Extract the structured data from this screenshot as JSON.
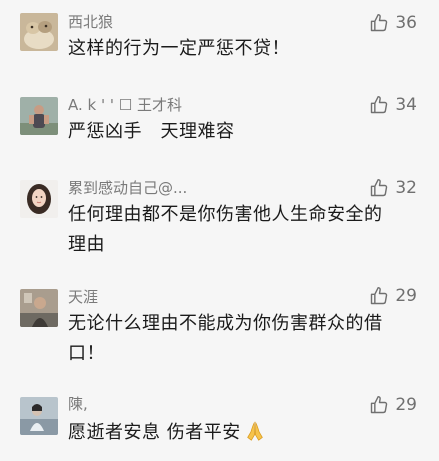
{
  "comments": [
    {
      "name": "西北狼",
      "likes": "36",
      "text": [
        "这样的行为一定严惩不贷！"
      ]
    },
    {
      "name": "A. k ' ' ☐  王才科",
      "likes": "34",
      "text": [
        "严惩凶手　天理难容"
      ]
    },
    {
      "name": "累到感动自己@...",
      "likes": "32",
      "text": [
        "任何理由都不是你伤害他人生命安全的",
        "理由"
      ]
    },
    {
      "name": "天涯",
      "likes": "29",
      "text": [
        "无论什么理由不能成为你伤害群众的借",
        "口！"
      ]
    },
    {
      "name": "陳,",
      "likes": "29",
      "text": [
        "愿逝者安息 伤者平安"
      ]
    }
  ],
  "icons": {
    "like": "thumbs-up-outline-icon",
    "emoji": "folded-hands-emoji"
  },
  "colors": {
    "background": "#f6f6f6",
    "name": "#7a7a7a",
    "text": "#1b1b1b",
    "like": "#707070"
  }
}
